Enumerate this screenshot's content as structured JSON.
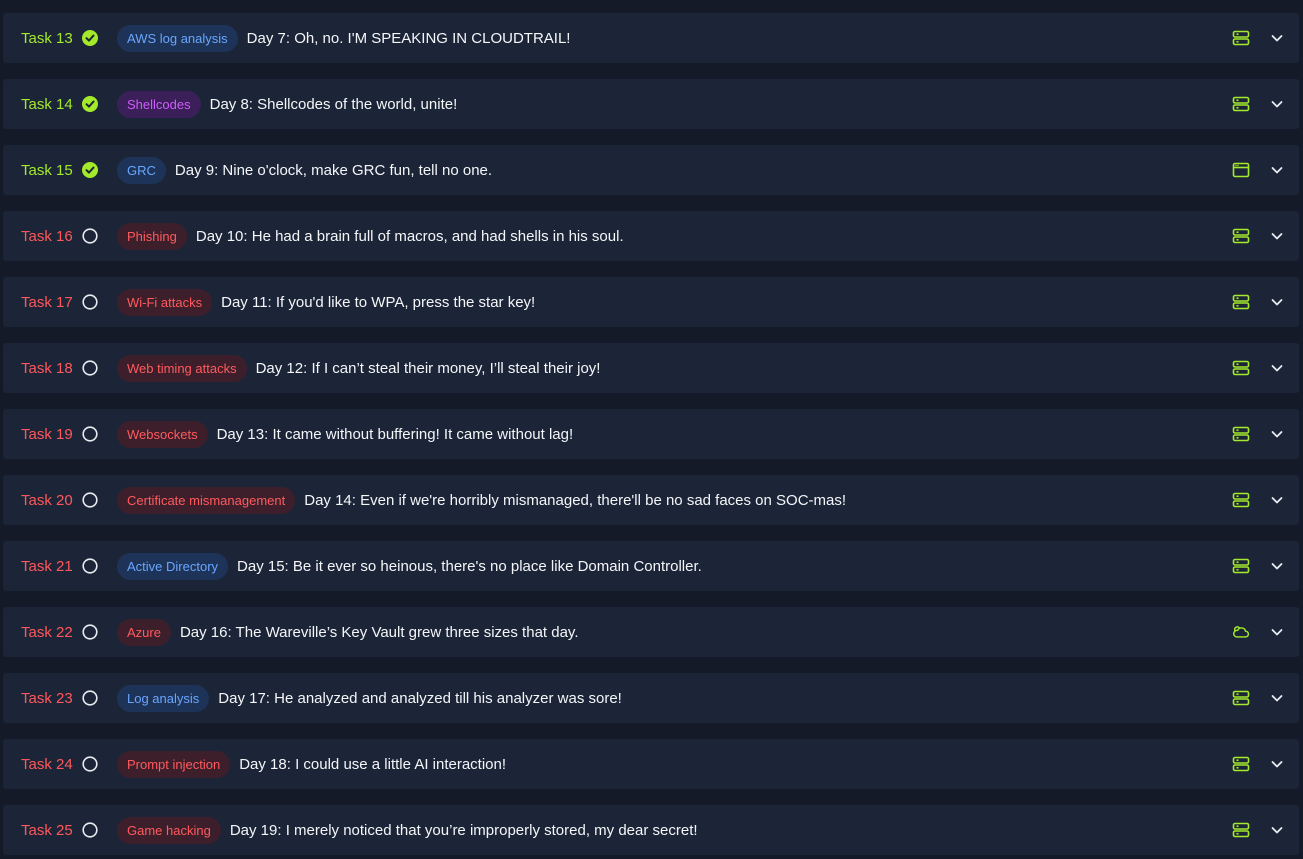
{
  "colors": {
    "page_bg": "#141a27",
    "row_bg": "#1c2538",
    "completed_green": "#a3ea2a",
    "incomplete_red": "#ff575a",
    "title_white": "#f4f6f8",
    "icon_green": "#a3ea2a"
  },
  "tasks": [
    {
      "label": "Task 13",
      "status": "completed",
      "tag": "AWS log analysis",
      "tag_color": "blue",
      "title": "Day 7: Oh, no. I'M SPEAKING IN CLOUDTRAIL!",
      "type_icon": "server-icon"
    },
    {
      "label": "Task 14",
      "status": "completed",
      "tag": "Shellcodes",
      "tag_color": "purple",
      "title": "Day 8: Shellcodes of the world, unite!",
      "type_icon": "server-icon"
    },
    {
      "label": "Task 15",
      "status": "completed",
      "tag": "GRC",
      "tag_color": "blue",
      "title": "Day 9: Nine o'clock, make GRC fun, tell no one.",
      "type_icon": "browser-window-icon"
    },
    {
      "label": "Task 16",
      "status": "incomplete",
      "tag": "Phishing",
      "tag_color": "red",
      "title": "Day 10: He had a brain full of macros, and had shells in his soul.",
      "type_icon": "server-icon"
    },
    {
      "label": "Task 17",
      "status": "incomplete",
      "tag": "Wi-Fi attacks",
      "tag_color": "red",
      "title": "Day 11: If you'd like to WPA, press the star key!",
      "type_icon": "server-icon"
    },
    {
      "label": "Task 18",
      "status": "incomplete",
      "tag": "Web timing attacks",
      "tag_color": "red",
      "title": "Day 12: If I can’t steal their money, I’ll steal their joy!",
      "type_icon": "server-icon"
    },
    {
      "label": "Task 19",
      "status": "incomplete",
      "tag": "Websockets",
      "tag_color": "red",
      "title": "Day 13: It came without buffering! It came without lag!",
      "type_icon": "server-icon"
    },
    {
      "label": "Task 20",
      "status": "incomplete",
      "tag": "Certificate mismanagement",
      "tag_color": "red",
      "title": "Day 14: Even if we're horribly mismanaged, there'll be no sad faces on SOC-mas!",
      "type_icon": "server-icon"
    },
    {
      "label": "Task 21",
      "status": "incomplete",
      "tag": "Active Directory",
      "tag_color": "blue",
      "title": "Day 15: Be it ever so heinous, there's no place like Domain Controller.",
      "type_icon": "server-icon"
    },
    {
      "label": "Task 22",
      "status": "incomplete",
      "tag": "Azure",
      "tag_color": "red",
      "title": "Day 16: The Wareville’s Key Vault grew three sizes that day.",
      "type_icon": "cloud-icon"
    },
    {
      "label": "Task 23",
      "status": "incomplete",
      "tag": "Log analysis",
      "tag_color": "blue",
      "title": "Day 17: He analyzed and analyzed till his analyzer was sore!",
      "type_icon": "server-icon"
    },
    {
      "label": "Task 24",
      "status": "incomplete",
      "tag": "Prompt injection",
      "tag_color": "red",
      "title": "Day 18: I could use a little AI interaction!",
      "type_icon": "server-icon"
    },
    {
      "label": "Task 25",
      "status": "incomplete",
      "tag": "Game hacking",
      "tag_color": "red",
      "title": "Day 19: I merely noticed that you’re improperly stored, my dear secret!",
      "type_icon": "server-icon"
    }
  ]
}
